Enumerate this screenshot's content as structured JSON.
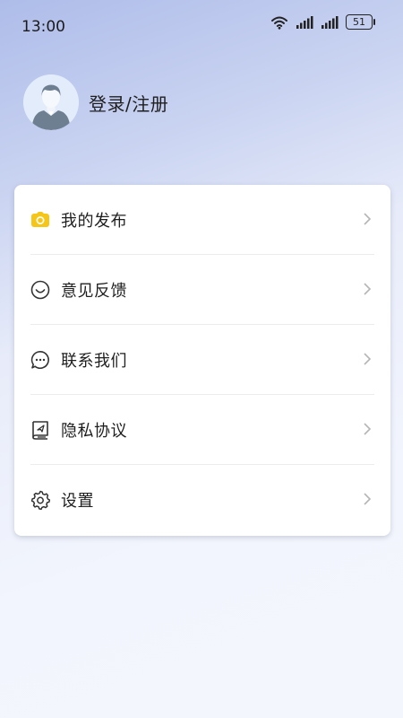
{
  "status_bar": {
    "time": "13:00",
    "battery": "51",
    "icons": [
      "wifi-icon",
      "signal-icon",
      "signal-icon",
      "battery-icon"
    ]
  },
  "profile": {
    "login_label": "登录/注册",
    "avatar_icon": "user-avatar-icon"
  },
  "menu": {
    "items": [
      {
        "label": "我的发布",
        "icon": "camera-icon"
      },
      {
        "label": "意见反馈",
        "icon": "smile-icon"
      },
      {
        "label": "联系我们",
        "icon": "chat-bubble-icon"
      },
      {
        "label": "隐私协议",
        "icon": "document-icon"
      },
      {
        "label": "设置",
        "icon": "gear-icon"
      }
    ]
  },
  "colors": {
    "accent_yellow": "#f5c518",
    "gradient_top": "#aebce9",
    "background": "#f4f6fd"
  }
}
